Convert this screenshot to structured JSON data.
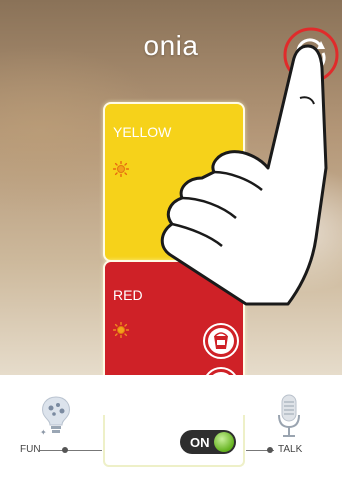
{
  "app": {
    "title": "onia"
  },
  "cards": {
    "yellow": {
      "label": "YELLOW",
      "color": "#f6d21a"
    },
    "red": {
      "label": "RED",
      "color": "#cf2127"
    }
  },
  "toggle": {
    "state_label": "ON"
  },
  "bottom": {
    "fun_label": "FUN",
    "talk_label": "TALK"
  },
  "icons": {
    "rotate": "rotate-icon",
    "sun": "sun-icon",
    "paint": "paint-can-icon",
    "flashlight": "flashlight-icon",
    "fun": "lightbulb-icon",
    "talk": "microphone-icon",
    "hand": "pointing-hand-icon"
  },
  "colors": {
    "highlight_circle": "#e02b2b",
    "toggle_on": "#64b21e"
  }
}
